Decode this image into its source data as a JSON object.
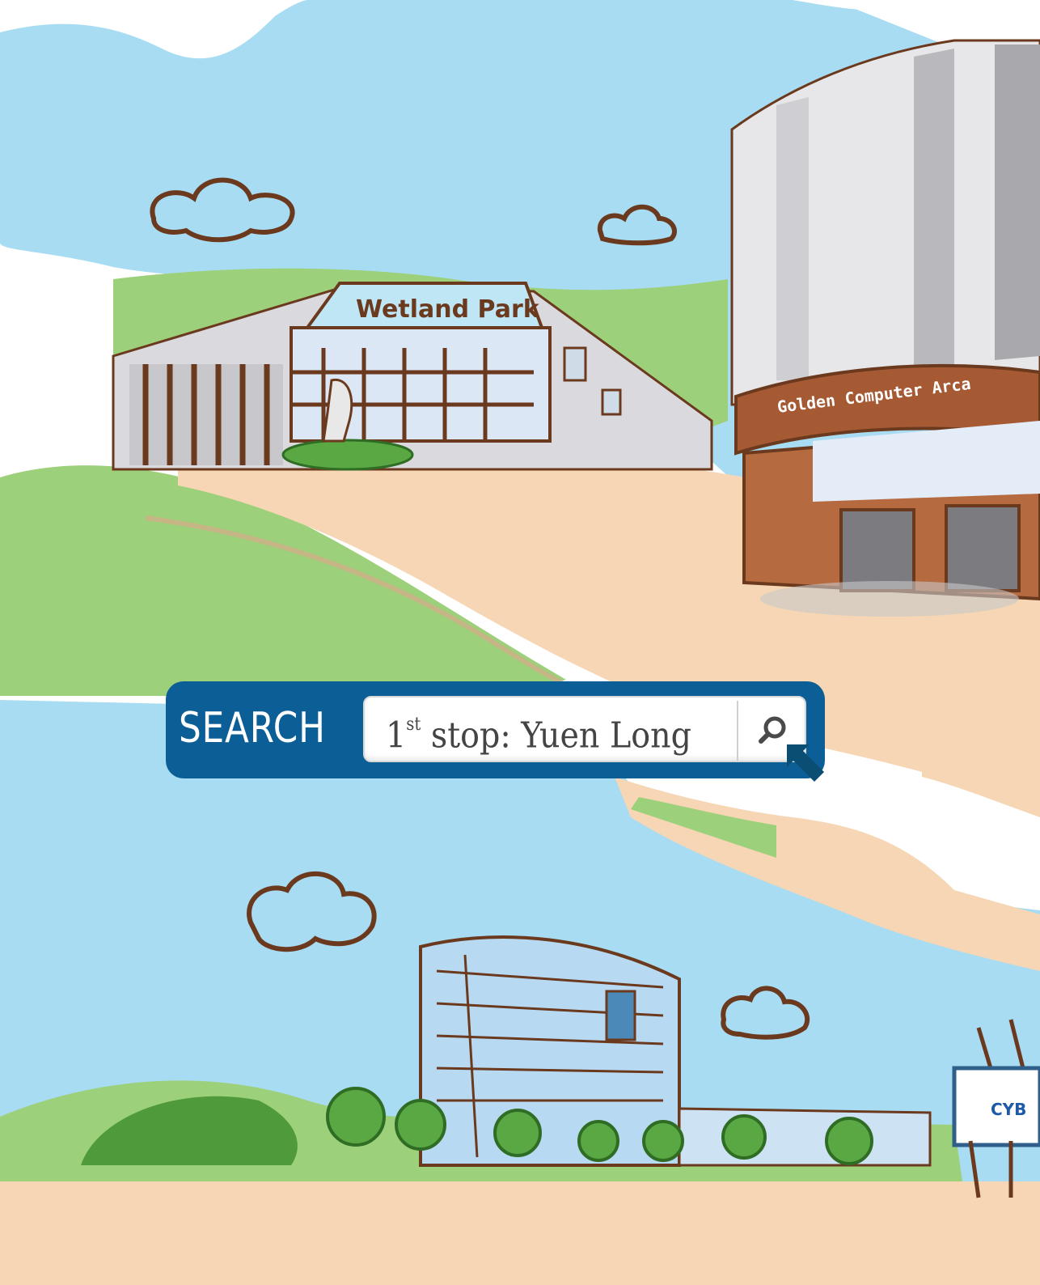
{
  "scene": {
    "signs": {
      "wetland": "Wetland Park",
      "arcade": "Golden Computer Arca",
      "cyber": "CYB"
    },
    "cyber_logo": "cyberport-logo",
    "colors": {
      "sky": "#a8dcf2",
      "grass": "#9dd07a",
      "road": "#f6d6b4",
      "outline": "#6b3a1e",
      "panel": "#0c5f96"
    }
  },
  "search": {
    "label": "SEARCH",
    "query_ordinal_num": "1",
    "query_ordinal_suffix": "st",
    "query_rest": " stop: Yuen Long",
    "button_icon": "search-icon",
    "cursor_icon": "cursor-arrow-icon"
  }
}
